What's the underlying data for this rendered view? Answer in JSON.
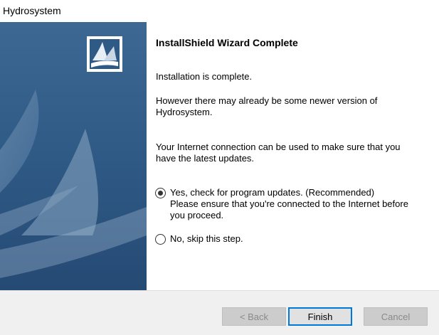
{
  "window": {
    "title": "Hydrosystem"
  },
  "banner": {
    "logo": "installshield-logo",
    "background_color": "#335a86"
  },
  "wizard": {
    "heading": "InstallShield Wizard Complete",
    "status_text": "Installation is complete.",
    "newer_version_line1": "However there may already be some newer version of",
    "newer_version_line2": "Hydrosystem.",
    "internet_line1": "Your Internet connection can be used to make sure that you",
    "internet_line2": "have the latest updates.",
    "options": [
      {
        "line1": "Yes, check for program updates. (Recommended)",
        "line2": "Please ensure that you're connected to the Internet before",
        "line3": "you proceed.",
        "checked": true
      },
      {
        "line1": "No, skip this step.",
        "checked": false
      }
    ]
  },
  "buttons": {
    "back": "< Back",
    "finish": "Finish",
    "cancel": "Cancel"
  },
  "colors": {
    "accent": "#0078d7",
    "footer_bg": "#f0f0f0"
  }
}
